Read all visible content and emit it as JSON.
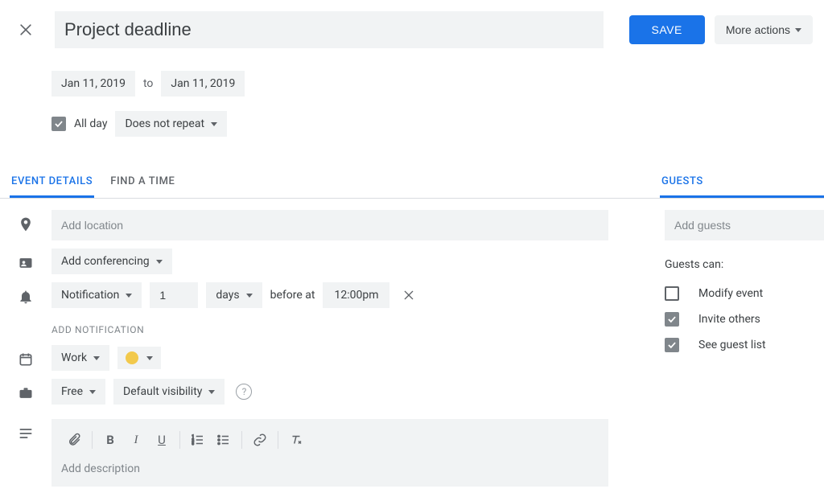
{
  "header": {
    "title_value": "Project deadline",
    "save_label": "SAVE",
    "more_actions_label": "More actions"
  },
  "dates": {
    "start": "Jan 11, 2019",
    "to_label": "to",
    "end": "Jan 11, 2019",
    "all_day_label": "All day",
    "all_day_checked": true,
    "recurrence": "Does not repeat"
  },
  "tabs": {
    "event_details": "EVENT DETAILS",
    "find_a_time": "FIND A TIME",
    "guests": "GUESTS"
  },
  "details": {
    "location_placeholder": "Add location",
    "conferencing_label": "Add conferencing",
    "notification": {
      "type": "Notification",
      "amount": "1",
      "unit": "days",
      "before_at": "before at",
      "time": "12:00pm"
    },
    "add_notification_label": "ADD NOTIFICATION",
    "calendar": "Work",
    "color": "#f2c94c",
    "availability": "Free",
    "visibility": "Default visibility",
    "description_placeholder": "Add description"
  },
  "guests": {
    "add_guests_placeholder": "Add guests",
    "can_label": "Guests can:",
    "permissions": [
      {
        "label": "Modify event",
        "checked": false
      },
      {
        "label": "Invite others",
        "checked": true
      },
      {
        "label": "See guest list",
        "checked": true
      }
    ]
  }
}
